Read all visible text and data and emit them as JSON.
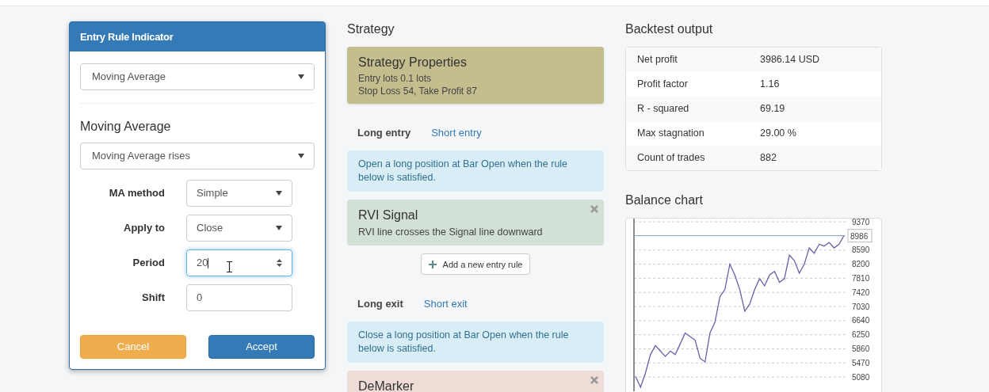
{
  "dialog": {
    "title": "Entry Rule Indicator",
    "indicator_select": {
      "value": "Moving Average"
    },
    "section_title": "Moving Average",
    "rule_select": {
      "value": "Moving Average rises"
    },
    "params": [
      {
        "label": "MA method",
        "kind": "select",
        "value": "Simple",
        "focused": false
      },
      {
        "label": "Apply to",
        "kind": "select",
        "value": "Close",
        "focused": false
      },
      {
        "label": "Period",
        "kind": "number",
        "value": "20",
        "focused": true
      },
      {
        "label": "Shift",
        "kind": "text",
        "value": "0",
        "focused": false
      }
    ],
    "buttons": [
      {
        "label": "Cancel",
        "kind": "cancel"
      },
      {
        "label": "Accept",
        "kind": "accept"
      }
    ]
  },
  "strategy": {
    "title": "Strategy",
    "properties": {
      "title": "Strategy Properties",
      "lines": [
        "Entry lots 0.1 lots",
        "Stop Loss 54, Take Profit 87"
      ]
    },
    "sections": [
      {
        "tabs": [
          {
            "label": "Long entry",
            "selected": true
          },
          {
            "label": "Short entry",
            "selected": false
          }
        ],
        "note": "Open a long position at Bar Open when the rule below is satisfied.",
        "rules": [
          {
            "title": "RVI Signal",
            "description": "RVI line crosses the Signal line downward",
            "color": "#d3e0d6"
          }
        ],
        "add_button": "Add a new entry rule"
      },
      {
        "tabs": [
          {
            "label": "Long exit",
            "selected": true
          },
          {
            "label": "Short exit",
            "selected": false
          }
        ],
        "note": "Close a long position at Bar Open when the rule below is satisfied.",
        "rules": [
          {
            "title": "DeMarker",
            "color": "#efdcd6"
          }
        ]
      }
    ]
  },
  "backtest": {
    "title": "Backtest output",
    "rows": [
      {
        "label": "Net profit",
        "value": "3986.14 USD"
      },
      {
        "label": "Profit factor",
        "value": "1.16"
      },
      {
        "label": "R - squared",
        "value": "69.19"
      },
      {
        "label": "Max stagnation",
        "value": "29.00 %"
      },
      {
        "label": "Count of trades",
        "value": "882"
      }
    ]
  },
  "balance_chart": {
    "title": "Balance chart",
    "chart_data": {
      "type": "line",
      "yticks": [
        5080,
        5470,
        5860,
        6250,
        6640,
        7030,
        7420,
        7810,
        8200,
        8590,
        9370
      ],
      "grid": true,
      "ylim": [
        4690,
        9460
      ],
      "series": [
        {
          "color": "#6a5fa8",
          "values": [
            5100,
            4800,
            5200,
            5700,
            5950,
            5800,
            5650,
            5800,
            5700,
            6000,
            6300,
            6200,
            6100,
            5600,
            5500,
            6300,
            6600,
            7300,
            7500,
            8200,
            7900,
            7500,
            6900,
            7100,
            7500,
            7800,
            7600,
            7900,
            8000,
            7700,
            7800,
            8450,
            8300,
            7950,
            8200,
            8650,
            8500,
            8750,
            8700,
            8800,
            8650,
            8750,
            8990
          ]
        }
      ],
      "ref_lines": [
        {
          "axis": "y",
          "value": 8986,
          "label": "8986"
        }
      ]
    }
  }
}
